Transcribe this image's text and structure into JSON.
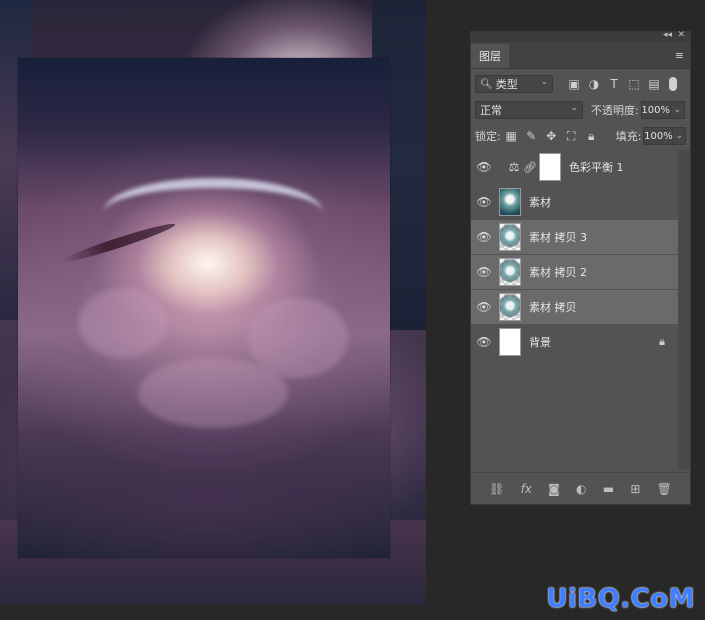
{
  "panel": {
    "tab_label": "图层",
    "collapse_glyph": "◂◂",
    "close_glyph": "✕",
    "menu_glyph": "≡",
    "filter": {
      "selected": "类型"
    },
    "blend_mode": {
      "selected": "正常"
    },
    "opacity": {
      "label": "不透明度:",
      "value": "100%"
    },
    "lock": {
      "label": "锁定:"
    },
    "fill": {
      "label": "填充:",
      "value": "100%"
    }
  },
  "layers": [
    {
      "name": "色彩平衡 1",
      "type": "adjustment",
      "visible": true,
      "selected": false
    },
    {
      "name": "素材",
      "type": "image",
      "visible": true,
      "selected": false
    },
    {
      "name": "素材 拷贝 3",
      "type": "image",
      "visible": true,
      "selected": true
    },
    {
      "name": "素材 拷贝 2",
      "type": "image",
      "visible": true,
      "selected": true
    },
    {
      "name": "素材 拷贝",
      "type": "image",
      "visible": true,
      "selected": true
    },
    {
      "name": "背景",
      "type": "background",
      "visible": true,
      "selected": false,
      "locked": true
    }
  ],
  "watermark": {
    "text": "UiBQ.CoM"
  },
  "icons": {
    "eye": "👁",
    "arrow": "⌄",
    "lock": "🔒",
    "adjustment": "⚖",
    "chain": "⛓"
  }
}
